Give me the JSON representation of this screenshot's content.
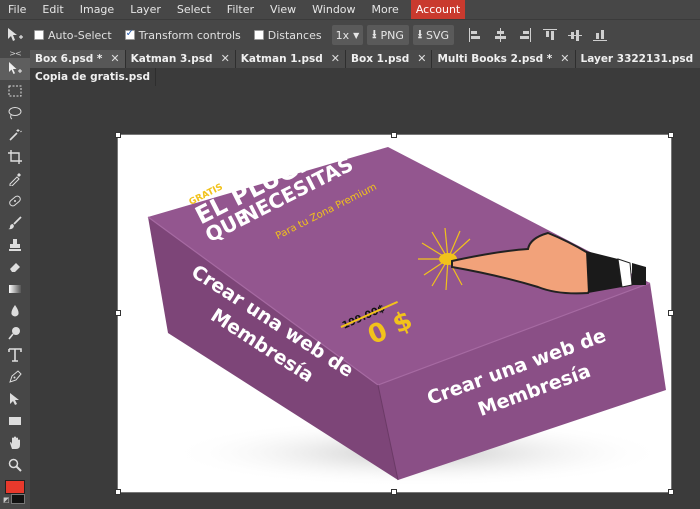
{
  "menu": {
    "items": [
      "File",
      "Edit",
      "Image",
      "Layer",
      "Select",
      "Filter",
      "View",
      "Window",
      "More"
    ],
    "account": "Account"
  },
  "options": {
    "auto_select": "Auto-Select",
    "transform_controls": "Transform controls",
    "distances": "Distances",
    "zoom": "1x",
    "png": "PNG",
    "svg": "SVG"
  },
  "tabs": [
    "Box 6.psd *",
    "Katman 3.psd",
    "Katman 1.psd",
    "Box 1.psd",
    "Multi Books 2.psd *",
    "Layer 3322131.psd",
    "Copia de gratis.psd"
  ],
  "artwork": {
    "tag": "GRATIS",
    "title_line1": "EL PLUGIN",
    "title_line2": "QUE",
    "title_line3": "NECESITAS",
    "subtitle": "Para tu Zona Premium",
    "side_text_line1": "Crear una web de",
    "side_text_line2": "Membresía",
    "front_text_line1": "Crear una web de",
    "front_text_line2": "Membresía",
    "old_price": "199.00$",
    "new_price": "0 $"
  },
  "colors": {
    "accent": "#c93a2e",
    "box_purple": "#8a4f86",
    "box_top": "#93568f",
    "box_side": "#7d4578",
    "yellow": "#f2c21b"
  }
}
